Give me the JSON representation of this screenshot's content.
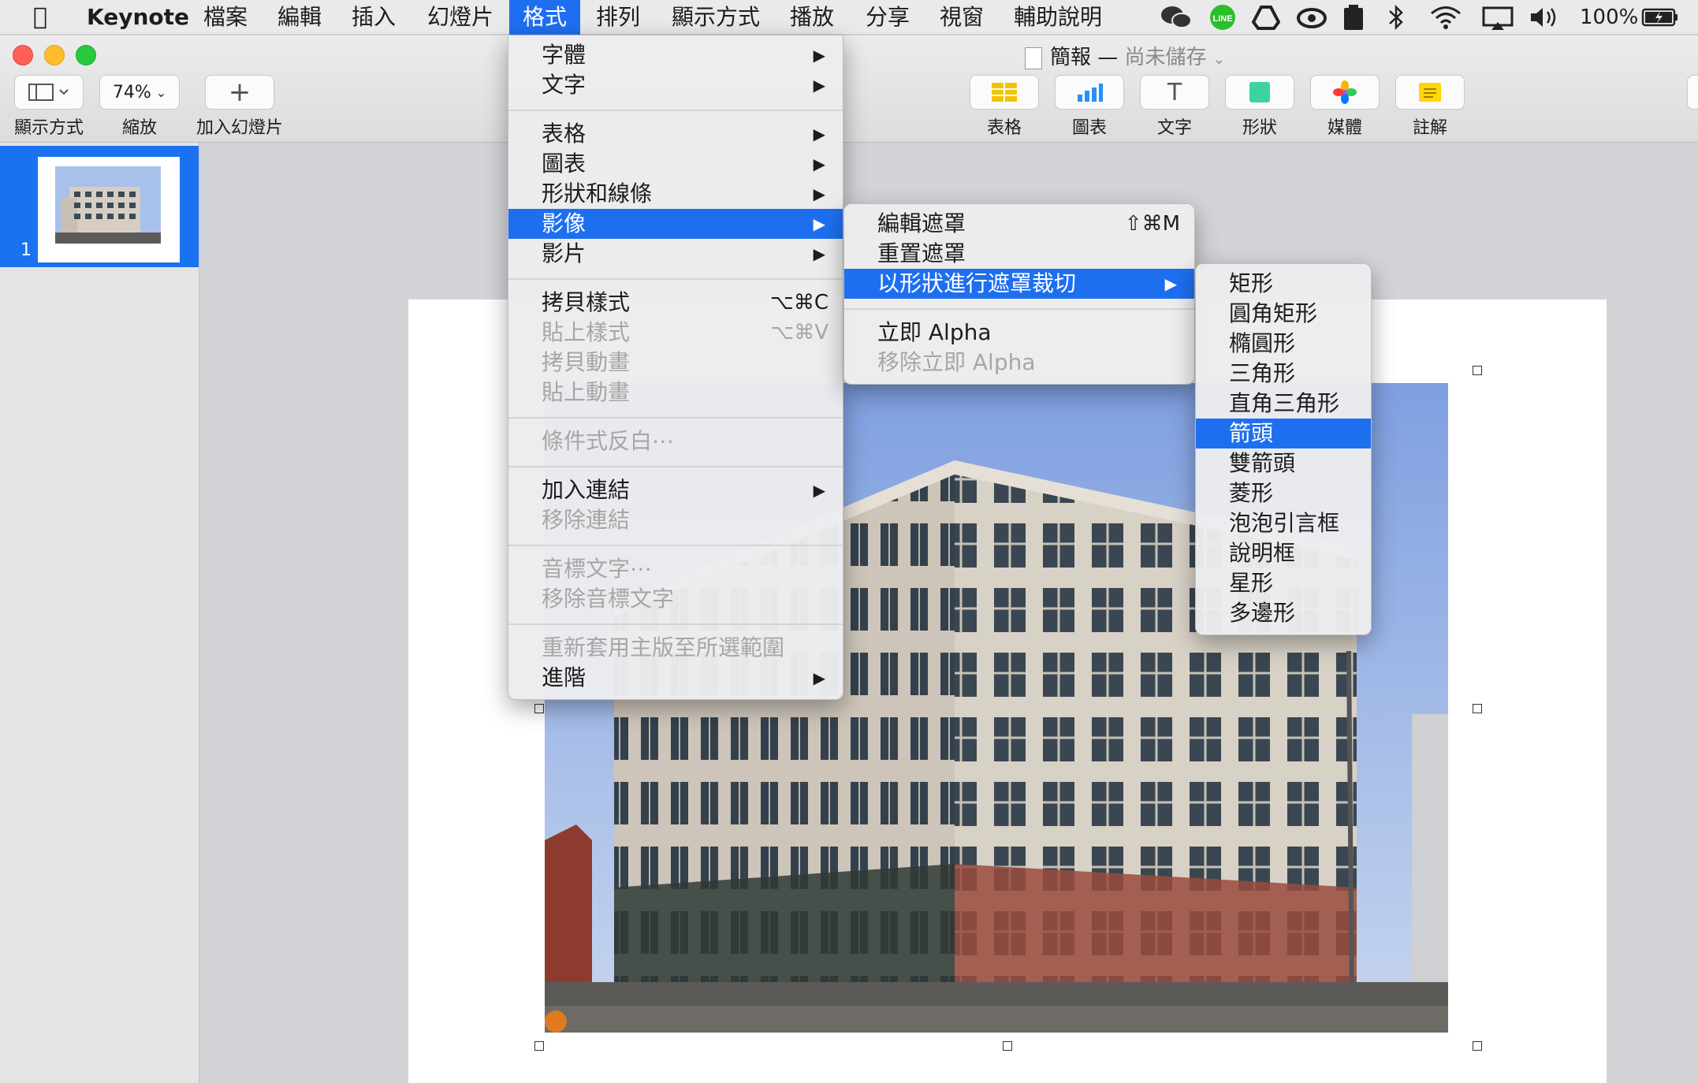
{
  "menubar": {
    "app_name": "Keynote",
    "items": [
      "檔案",
      "編輯",
      "插入",
      "幻燈片",
      "格式",
      "排列",
      "顯示方式",
      "播放",
      "分享",
      "視窗",
      "輔助說明"
    ],
    "active_item": "格式",
    "status": {
      "line_label": "LINE",
      "battery": "100%"
    }
  },
  "window": {
    "title": "簡報",
    "title_separator": "—",
    "save_state": "尚未儲存",
    "toolbar_left": [
      {
        "label": "顯示方式",
        "icon": "sidebar-layout-icon"
      },
      {
        "label": "縮放",
        "value": "74%"
      },
      {
        "label": "加入幻燈片",
        "icon": "plus-icon"
      }
    ],
    "toolbar_right": [
      {
        "label": "表格",
        "icon": "table-icon"
      },
      {
        "label": "圖表",
        "icon": "chart-icon"
      },
      {
        "label": "文字",
        "icon": "text-icon"
      },
      {
        "label": "形狀",
        "icon": "shape-icon"
      },
      {
        "label": "媒體",
        "icon": "media-icon"
      },
      {
        "label": "註解",
        "icon": "comment-icon"
      }
    ]
  },
  "sidebar": {
    "slides": [
      {
        "number": "1"
      }
    ]
  },
  "format_menu": {
    "items": [
      {
        "label": "字體",
        "submenu": true
      },
      {
        "label": "文字",
        "submenu": true
      },
      {
        "label": "表格",
        "submenu": true
      },
      {
        "label": "圖表",
        "submenu": true
      },
      {
        "label": "形狀和線條",
        "submenu": true
      },
      {
        "label": "影像",
        "submenu": true,
        "highlighted": true
      },
      {
        "label": "影片",
        "submenu": true
      },
      {
        "label": "拷貝樣式",
        "shortcut": "⌥⌘C"
      },
      {
        "label": "貼上樣式",
        "shortcut": "⌥⌘V",
        "disabled": true
      },
      {
        "label": "拷貝動畫",
        "disabled": true
      },
      {
        "label": "貼上動畫",
        "disabled": true
      },
      {
        "label": "條件式反白⋯",
        "disabled": true
      },
      {
        "label": "加入連結",
        "submenu": true
      },
      {
        "label": "移除連結",
        "disabled": true
      },
      {
        "label": "音標文字⋯",
        "disabled": true
      },
      {
        "label": "移除音標文字",
        "disabled": true
      },
      {
        "label": "重新套用主版至所選範圍",
        "disabled": true
      },
      {
        "label": "進階",
        "submenu": true
      }
    ]
  },
  "image_submenu": {
    "items": [
      {
        "label": "編輯遮罩",
        "shortcut": "⇧⌘M"
      },
      {
        "label": "重置遮罩"
      },
      {
        "label": "以形狀進行遮罩裁切",
        "submenu": true,
        "highlighted": true
      },
      {
        "label": "立即 Alpha"
      },
      {
        "label": "移除立即 Alpha",
        "disabled": true
      }
    ]
  },
  "shape_submenu": {
    "items": [
      "矩形",
      "圓角矩形",
      "橢圓形",
      "三角形",
      "直角三角形",
      "箭頭",
      "雙箭頭",
      "菱形",
      "泡泡引言框",
      "說明框",
      "星形",
      "多邊形"
    ],
    "highlighted": "箭頭"
  },
  "colors": {
    "accent": "#1e6ff0",
    "menubar_bg": "#eaeaea",
    "sky": "#9db8e6",
    "building": "#d9d2c8"
  }
}
